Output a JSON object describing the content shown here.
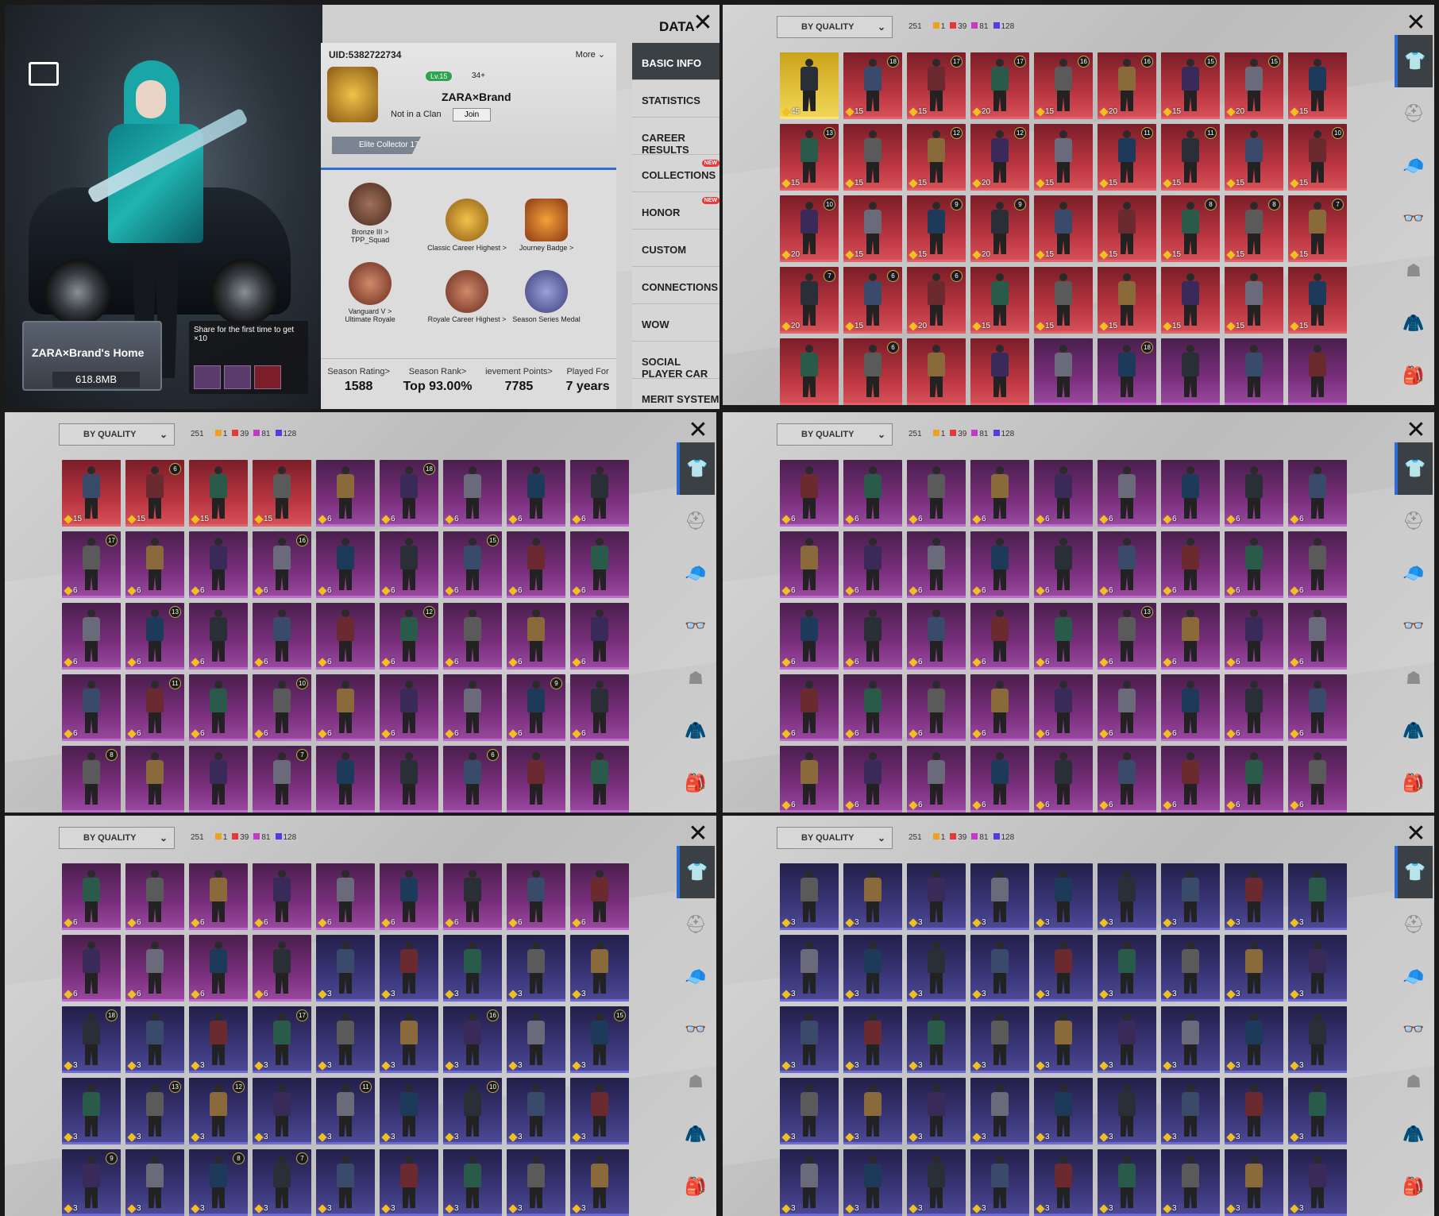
{
  "profile": {
    "data_title": "DATA",
    "uid": "UID:5382722734",
    "more": "More",
    "level": "Lv.15",
    "followers": "34+",
    "player_name": "ZARA×Brand",
    "clan_status": "Not in a Clan",
    "join": "Join",
    "collector": "Elite Collector 17",
    "home_name": "ZARA×Brand's Home",
    "home_size": "618.8MB",
    "share_text": "Share for the first time to get",
    "share_reward": "×10",
    "medals": [
      {
        "label": "Bronze III >",
        "sub": "TPP_Squad"
      },
      {
        "label": "Classic Career Highest >",
        "sub": ""
      },
      {
        "label": "Journey Badge >",
        "sub": ""
      },
      {
        "label": "Vanguard V >",
        "sub": "Ultimate Royale"
      },
      {
        "label": "Royale Career Highest >",
        "sub": ""
      },
      {
        "label": "Season Series Medal",
        "sub": ""
      }
    ],
    "stats": [
      {
        "label": "Season Rating>",
        "value": "1588"
      },
      {
        "label": "Season Rank>",
        "value": "Top 93.00%"
      },
      {
        "label": "ievement Points>",
        "value": "7785"
      },
      {
        "label": "Played For",
        "value": "7 years"
      }
    ],
    "menu": [
      {
        "label": "BASIC INFO",
        "active": true
      },
      {
        "label": "STATISTICS"
      },
      {
        "label": "CAREER RESULTS"
      },
      {
        "label": "COLLECTIONS",
        "new": "NEW"
      },
      {
        "label": "HONOR",
        "new": "NEW"
      },
      {
        "label": "CUSTOM"
      },
      {
        "label": "CONNECTIONS"
      },
      {
        "label": "WOW"
      },
      {
        "label": "SOCIAL PLAYER CAR"
      },
      {
        "label": "MERIT SYSTEM"
      }
    ]
  },
  "collection": {
    "sort_label": "BY QUALITY",
    "total": "251",
    "tiers": [
      {
        "color": "#f0a020",
        "count": "1"
      },
      {
        "color": "#e23a3a",
        "count": "39"
      },
      {
        "color": "#c23ac8",
        "count": "81"
      },
      {
        "color": "#5a3ae0",
        "count": "128"
      }
    ],
    "categories": [
      "outfit-icon",
      "helmet-icon",
      "hat-icon",
      "glasses-icon",
      "mask-icon",
      "jacket-icon",
      "backpack-icon"
    ]
  },
  "pages": [
    {
      "rows": [
        [
          "gold:45",
          "red:15:18",
          "red:15:17",
          "red:20:17",
          "red:15:16",
          "red:20:16",
          "red:15:15",
          "red:20:15",
          "red:15"
        ],
        [
          "red:15:13",
          "red:15",
          "red:15:12",
          "red:20:12",
          "red:15",
          "red:15:11",
          "red:15:11",
          "red:15",
          "red:15:10"
        ],
        [
          "red:20:10",
          "red:15",
          "red:15:9",
          "red:20:9",
          "red:15",
          "red:15",
          "red:15:8",
          "red:15:8",
          "red:15:7"
        ],
        [
          "red:20:7",
          "red:15:6",
          "red:20:6",
          "red:15",
          "red:15",
          "red:15",
          "red:15",
          "red:15",
          "red:15"
        ],
        [
          "red:",
          "red::6",
          "red:",
          "red:",
          "pur:",
          "pur::18",
          "pur:",
          "pur:",
          "pur:"
        ]
      ]
    },
    {
      "rows": [
        [
          "red:15",
          "red:15:6",
          "red:15",
          "red:15",
          "pur:6",
          "pur:6:18",
          "pur:6",
          "pur:6",
          "pur:6"
        ],
        [
          "pur:6:17",
          "pur:6",
          "pur:6",
          "pur:6:16",
          "pur:6",
          "pur:6",
          "pur:6:15",
          "pur:6",
          "pur:6"
        ],
        [
          "pur:6",
          "pur:6:13",
          "pur:6",
          "pur:6",
          "pur:6",
          "pur:6:12",
          "pur:6",
          "pur:6",
          "pur:6"
        ],
        [
          "pur:6",
          "pur:6:11",
          "pur:6",
          "pur:6:10",
          "pur:6",
          "pur:6",
          "pur:6",
          "pur:6:9",
          "pur:6"
        ],
        [
          "pur::8",
          "pur:",
          "pur:",
          "pur::7",
          "pur:",
          "pur:",
          "pur::6",
          "pur:",
          "pur:"
        ]
      ]
    },
    {
      "rows": [
        [
          "pur:6",
          "pur:6",
          "pur:6",
          "pur:6",
          "pur:6",
          "pur:6",
          "pur:6",
          "pur:6",
          "pur:6"
        ],
        [
          "pur:6",
          "pur:6",
          "pur:6",
          "pur:6",
          "pur:6",
          "pur:6",
          "pur:6",
          "pur:6",
          "pur:6"
        ],
        [
          "pur:6",
          "pur:6",
          "pur:6",
          "pur:6",
          "pur:6",
          "pur:6:13",
          "pur:6",
          "pur:6",
          "pur:6"
        ],
        [
          "pur:6",
          "pur:6",
          "pur:6",
          "pur:6",
          "pur:6",
          "pur:6",
          "pur:6",
          "pur:6",
          "pur:6"
        ],
        [
          "pur:6",
          "pur:6",
          "pur:6",
          "pur:6",
          "pur:6",
          "pur:6",
          "pur:6",
          "pur:6",
          "pur:6"
        ]
      ]
    },
    {
      "rows": [
        [
          "pur:6",
          "pur:6",
          "pur:6",
          "pur:6",
          "pur:6",
          "pur:6",
          "pur:6",
          "pur:6",
          "pur:6"
        ],
        [
          "pur:6",
          "pur:6",
          "pur:6",
          "pur:6",
          "blu:3",
          "blu:3",
          "blu:3",
          "blu:3",
          "blu:3"
        ],
        [
          "blu:3:18",
          "blu:3",
          "blu:3",
          "blu:3:17",
          "blu:3",
          "blu:3",
          "blu:3:16",
          "blu:3",
          "blu:3:15"
        ],
        [
          "blu:3",
          "blu:3:13",
          "blu:3:12",
          "blu:3",
          "blu:3:11",
          "blu:3",
          "blu:3:10",
          "blu:3",
          "blu:3"
        ],
        [
          "blu:3:9",
          "blu:3",
          "blu:3:8",
          "blu:3:7",
          "blu:3",
          "blu:3",
          "blu:3",
          "blu:3",
          "blu:3"
        ]
      ]
    },
    {
      "rows": [
        [
          "blu:3",
          "blu:3",
          "blu:3",
          "blu:3",
          "blu:3",
          "blu:3",
          "blu:3",
          "blu:3",
          "blu:3"
        ],
        [
          "blu:3",
          "blu:3",
          "blu:3",
          "blu:3",
          "blu:3",
          "blu:3",
          "blu:3",
          "blu:3",
          "blu:3"
        ],
        [
          "blu:3",
          "blu:3",
          "blu:3",
          "blu:3",
          "blu:3",
          "blu:3",
          "blu:3",
          "blu:3",
          "blu:3"
        ],
        [
          "blu:3",
          "blu:3",
          "blu:3",
          "blu:3",
          "blu:3",
          "blu:3",
          "blu:3",
          "blu:3",
          "blu:3"
        ],
        [
          "blu:3",
          "blu:3",
          "blu:3",
          "blu:3",
          "blu:3",
          "blu:3",
          "blu:3",
          "blu:3",
          "blu:3"
        ]
      ]
    }
  ]
}
